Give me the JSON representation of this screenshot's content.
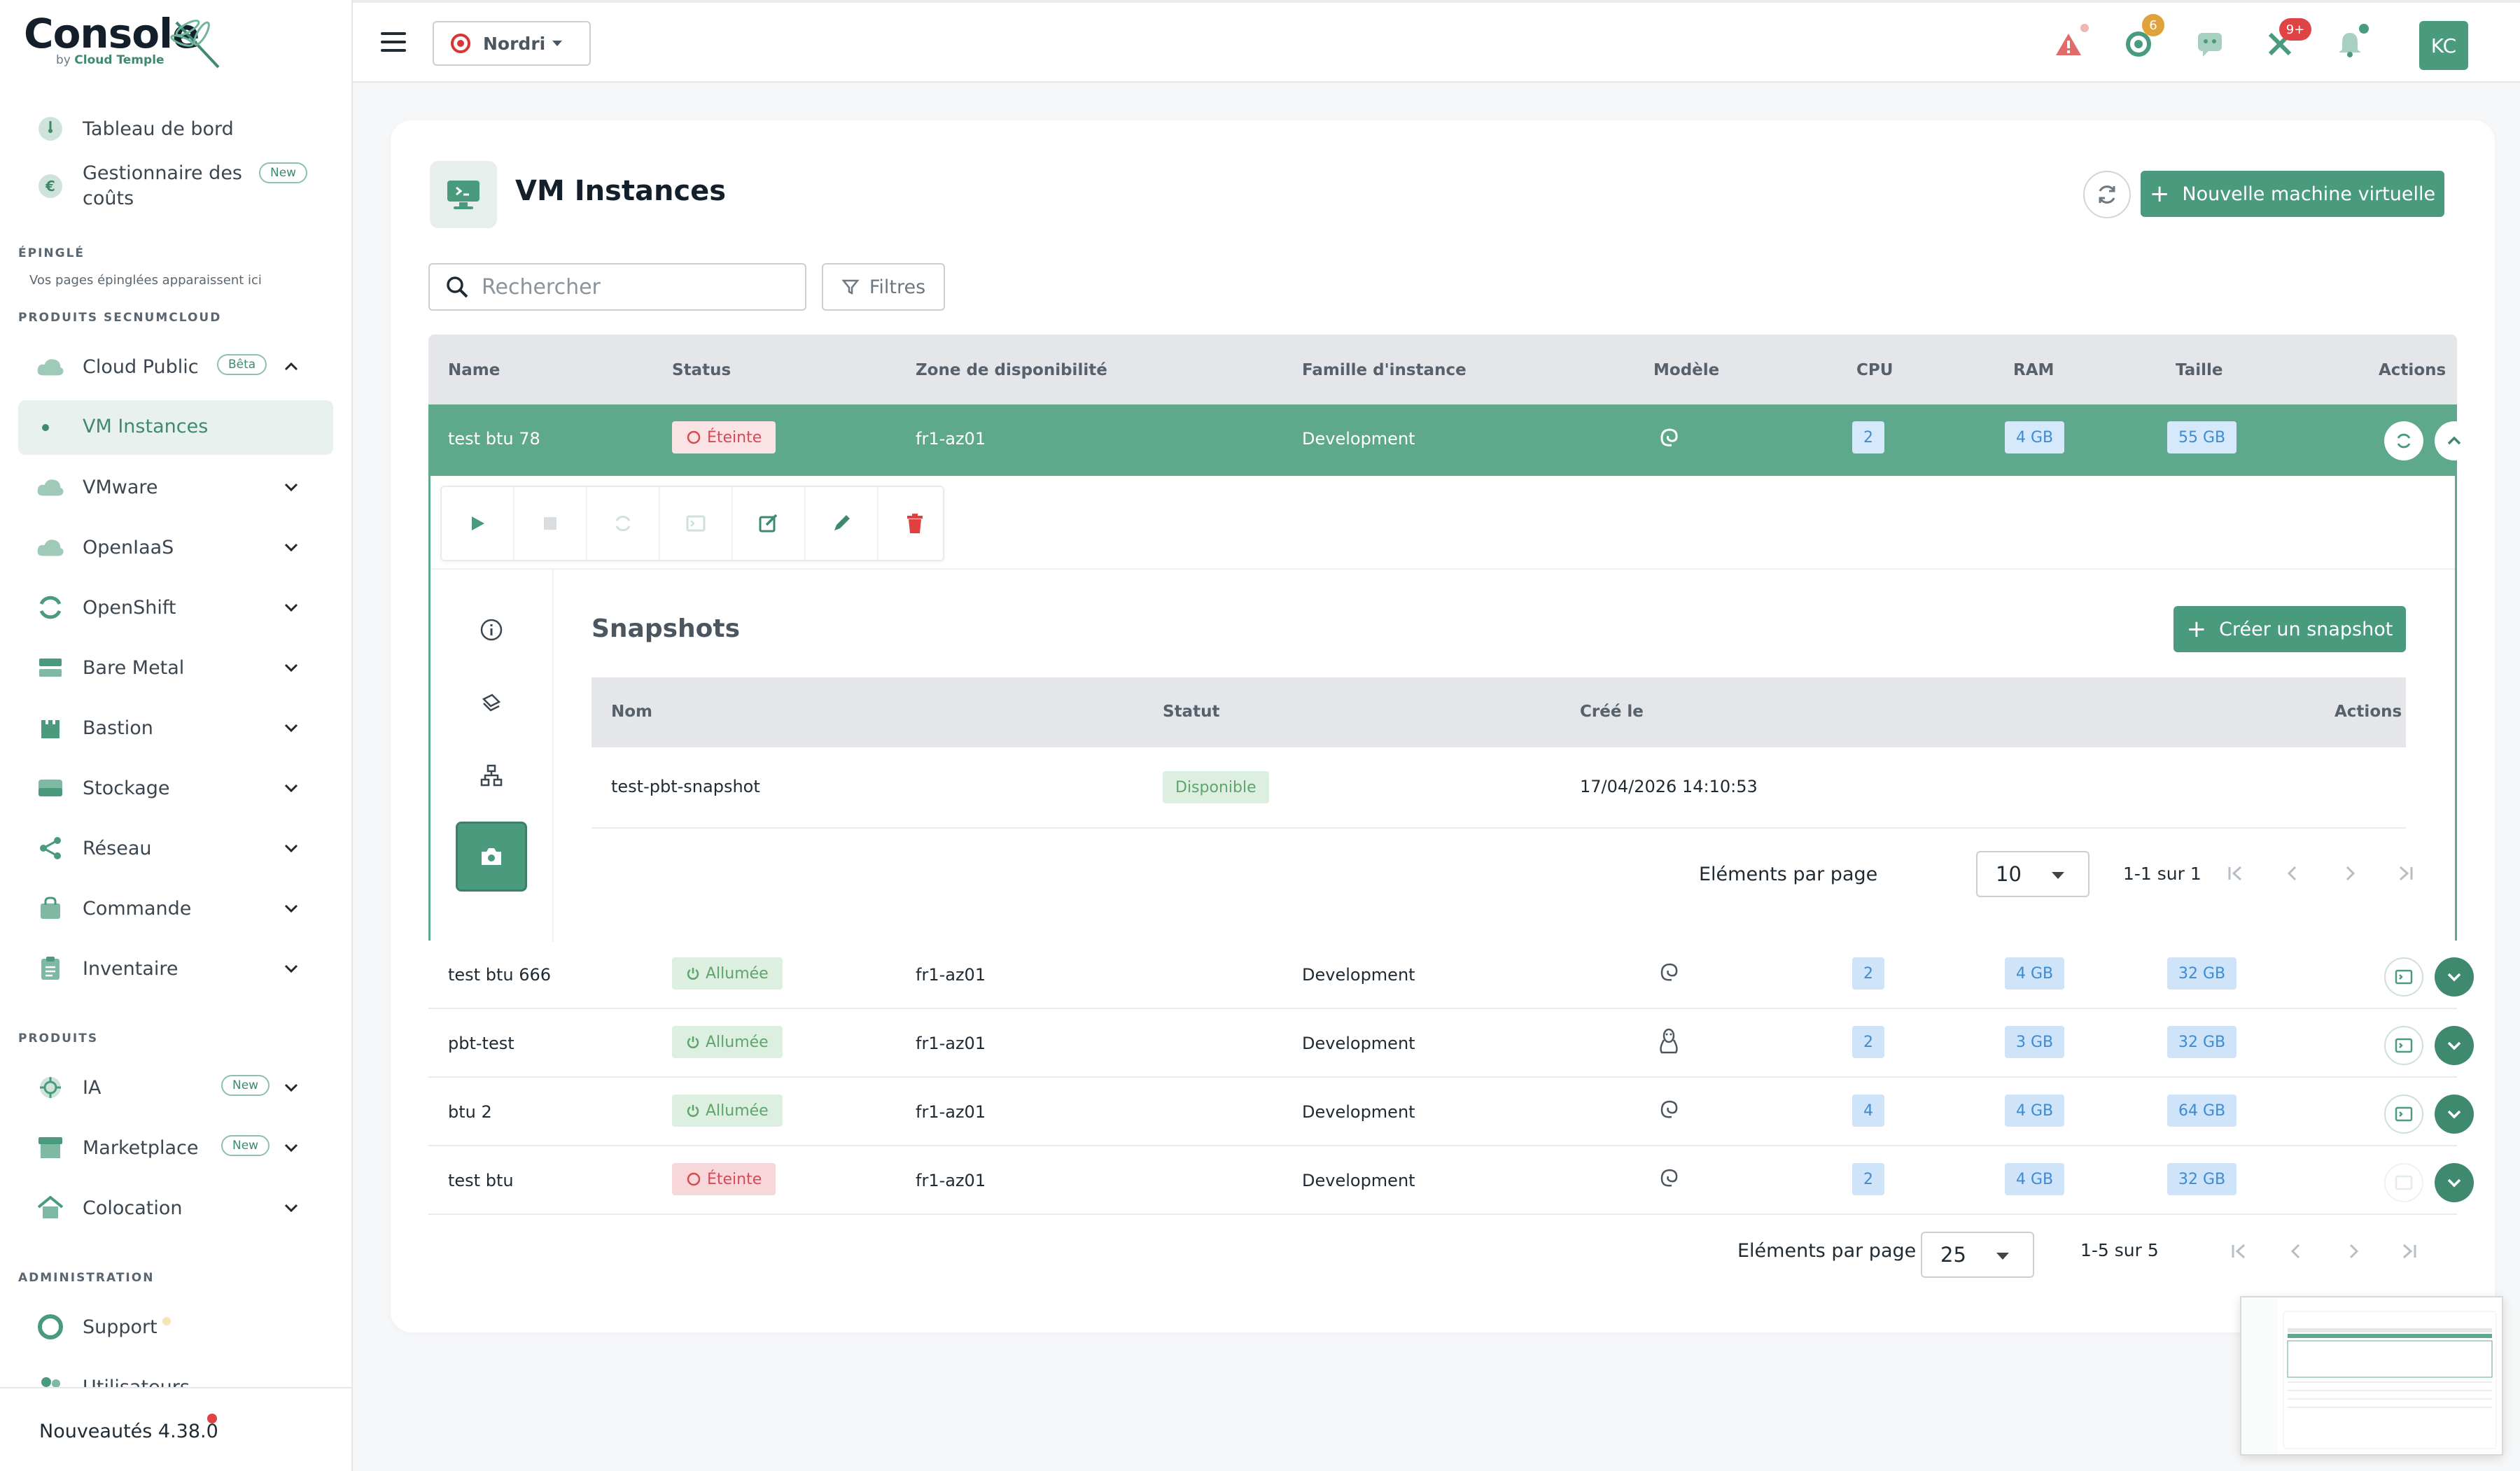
{
  "brand": {
    "name": "Console",
    "by": "by",
    "company": "Cloud Temple"
  },
  "sidebar": {
    "top_items": [
      {
        "label": "Tableau de bord"
      },
      {
        "label": "Gestionnaire des coûts",
        "badge": "New"
      }
    ],
    "pinned_title": "ÉPINGLÉ",
    "pinned_hint": "Vos pages épinglées apparaissent ici",
    "secnum_title": "PRODUITS SECNUMCLOUD",
    "secnum_items": [
      {
        "label": "Cloud Public",
        "badge": "Bêta"
      },
      {
        "label": "VM Instances"
      },
      {
        "label": "VMware"
      },
      {
        "label": "OpenIaaS"
      },
      {
        "label": "OpenShift"
      },
      {
        "label": "Bare Metal"
      },
      {
        "label": "Bastion"
      },
      {
        "label": "Stockage"
      },
      {
        "label": "Réseau"
      },
      {
        "label": "Commande"
      },
      {
        "label": "Inventaire"
      }
    ],
    "products_title": "PRODUITS",
    "product_items": [
      {
        "label": "IA",
        "badge": "New"
      },
      {
        "label": "Marketplace",
        "badge": "New"
      },
      {
        "label": "Colocation"
      }
    ],
    "admin_title": "ADMINISTRATION",
    "admin_items": [
      {
        "label": "Support"
      },
      {
        "label": "Utilisateurs"
      }
    ],
    "footer": "Nouveautés 4.38.0"
  },
  "topbar": {
    "tenant": "Nordri",
    "badges": {
      "ops": "6",
      "tools": "9+"
    },
    "avatar": "KC"
  },
  "page": {
    "title": "VM Instances",
    "new_button": "Nouvelle machine virtuelle",
    "search_placeholder": "Rechercher",
    "filters": "Filtres"
  },
  "table": {
    "columns": [
      "Name",
      "Status",
      "Zone de disponibilité",
      "Famille d'instance",
      "Modèle",
      "CPU",
      "RAM",
      "Taille",
      "Actions"
    ],
    "rows": [
      {
        "name": "test btu 78",
        "status": "Éteinte",
        "zone": "fr1-az01",
        "family": "Development",
        "model": "debian",
        "cpu": "2",
        "ram": "4 GB",
        "size": "55 GB"
      },
      {
        "name": "test btu 666",
        "status": "Allumée",
        "zone": "fr1-az01",
        "family": "Development",
        "model": "debian",
        "cpu": "2",
        "ram": "4 GB",
        "size": "32 GB"
      },
      {
        "name": "pbt-test",
        "status": "Allumée",
        "zone": "fr1-az01",
        "family": "Development",
        "model": "linux",
        "cpu": "2",
        "ram": "3 GB",
        "size": "32 GB"
      },
      {
        "name": "btu 2",
        "status": "Allumée",
        "zone": "fr1-az01",
        "family": "Development",
        "model": "debian",
        "cpu": "4",
        "ram": "4 GB",
        "size": "64 GB"
      },
      {
        "name": "test btu",
        "status": "Éteinte",
        "zone": "fr1-az01",
        "family": "Development",
        "model": "debian",
        "cpu": "2",
        "ram": "4 GB",
        "size": "32 GB"
      }
    ]
  },
  "snapshots": {
    "title": "Snapshots",
    "create_button": "Créer un snapshot",
    "columns": [
      "Nom",
      "Statut",
      "Créé le",
      "Actions"
    ],
    "rows": [
      {
        "name": "test-pbt-snapshot",
        "status": "Disponible",
        "created": "17/04/2026 14:10:53"
      }
    ],
    "pager": {
      "label": "Eléments par page",
      "per_page": "10",
      "range": "1-1 sur 1"
    }
  },
  "pager": {
    "label": "Eléments par page",
    "per_page": "25",
    "range": "1-5 sur 5"
  },
  "colors": {
    "accent": "#4a9b7d",
    "selected_row": "#5ea88b",
    "off": "#d74a53",
    "on": "#5ea56c",
    "info": "#3d8bd3"
  }
}
